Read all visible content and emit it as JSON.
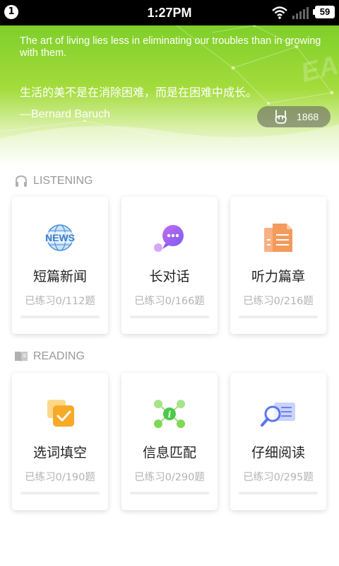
{
  "status_bar": {
    "notification_count": "1",
    "time": "1:27PM",
    "battery": "59",
    "icons": [
      "wifi-icon",
      "signal-icon",
      "battery-icon"
    ]
  },
  "banner": {
    "quote_en": "The art of living lies less in eliminating our troubles than in growing with them.",
    "quote_zh": "生活的美不是在消除困难，而是在困难中成长。",
    "author": "—Bernard Baruch",
    "like_count": "1868",
    "watermark": "EASY",
    "colors": {
      "green_top": "#7fcf2a",
      "green_mid": "#a4dc3c"
    }
  },
  "listening": {
    "title": "LISTENING",
    "icon": "headphones-icon",
    "cards": [
      {
        "title": "短篇新闻",
        "progress": "已练习0/112题",
        "done": 0,
        "total": 112,
        "icon": "news-globe-icon"
      },
      {
        "title": "长对话",
        "progress": "已练习0/166题",
        "done": 0,
        "total": 166,
        "icon": "chat-bubble-icon"
      },
      {
        "title": "听力篇章",
        "progress": "已练习0/216题",
        "done": 0,
        "total": 216,
        "icon": "document-icon"
      }
    ]
  },
  "reading": {
    "title": "READING",
    "icon": "book-icon",
    "cards": [
      {
        "title": "选词填空",
        "progress": "已练习0/190题",
        "done": 0,
        "total": 190,
        "icon": "checkbox-icon"
      },
      {
        "title": "信息匹配",
        "progress": "已练习0/290题",
        "done": 0,
        "total": 290,
        "icon": "info-network-icon"
      },
      {
        "title": "仔细阅读",
        "progress": "已练习0/295题",
        "done": 0,
        "total": 295,
        "icon": "magnifier-doc-icon"
      }
    ]
  }
}
